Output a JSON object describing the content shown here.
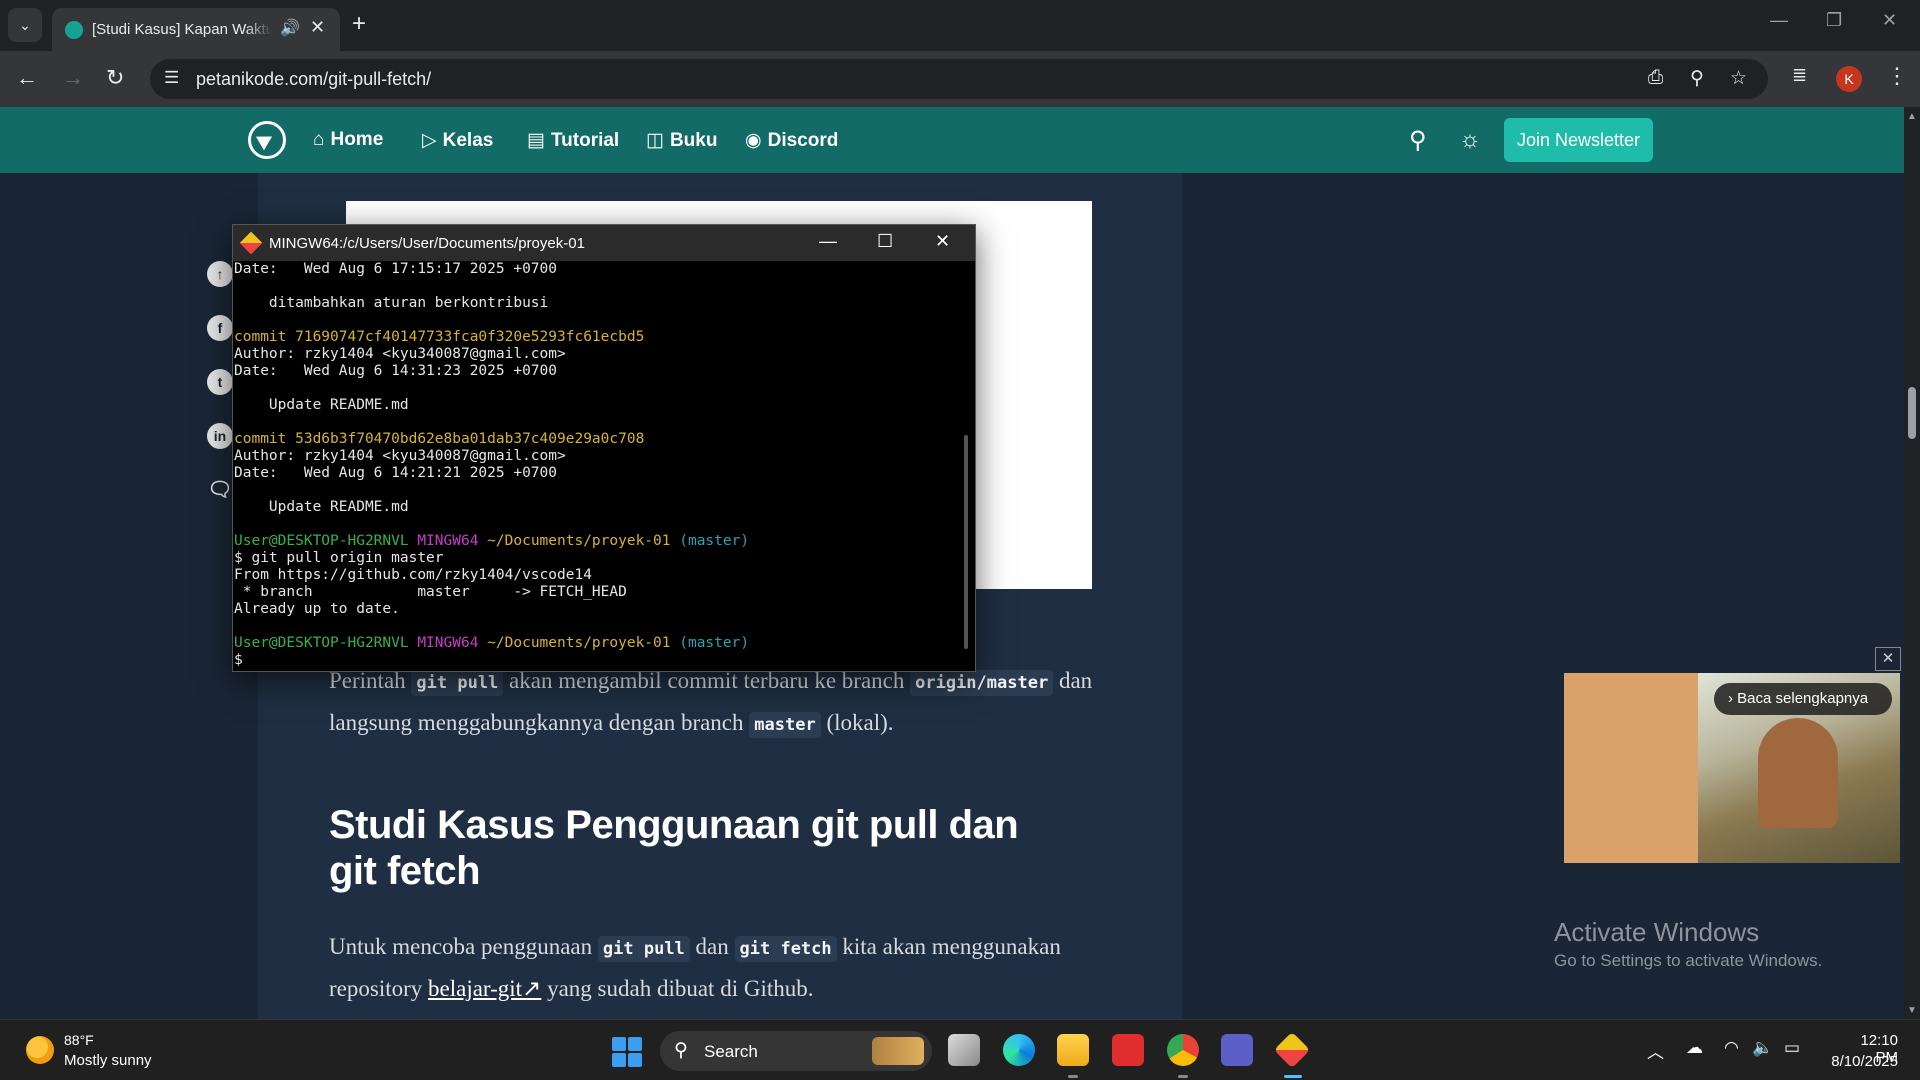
{
  "browser": {
    "tab_title": "[Studi Kasus] Kapan Waktu yang Tepat",
    "new_tab": "+",
    "url": "petanikode.com/git-pull-fetch/",
    "profile_initial": "K"
  },
  "site": {
    "nav": [
      {
        "label": "Home",
        "icon": "⌂"
      },
      {
        "label": "Kelas",
        "icon": "▷"
      },
      {
        "label": "Tutorial",
        "icon": "▤"
      },
      {
        "label": "Buku",
        "icon": "◫"
      },
      {
        "label": "Discord",
        "icon": "◉"
      }
    ],
    "join_label": "Join Newsletter",
    "accent": "#126b67",
    "button_color": "#1fbca9"
  },
  "article": {
    "para1_text1": "Perintah",
    "para1_code1": "git pull",
    "para1_text2": "akan mengambil commit terbaru ke branch",
    "para1_code2": "origin/master",
    "para1_text3": "dan langsung menggabungkannya dengan branch",
    "para1_code3": "master",
    "para1_text4": "(lokal).",
    "heading": "Studi Kasus Penggunaan git pull dan git fetch",
    "para2_text1": "Untuk mencoba penggunaan",
    "para2_code1": "git pull",
    "para2_text2": "dan",
    "para2_code2": "git fetch",
    "para2_text3": "kita akan",
    "para2_text4": "menggunakan repository",
    "para2_link": "belajar-git↗",
    "para2_text5": "yang sudah dibuat di Github."
  },
  "ad": {
    "cta": "› Baca selengkapnya",
    "close": "✕"
  },
  "watermark": {
    "title": "Activate Windows",
    "subtitle": "Go to Settings to activate Windows."
  },
  "terminal": {
    "title": "MINGW64:/c/Users/User/Documents/proyek-01",
    "lines": [
      {
        "segments": [
          {
            "t": "Date:   Wed Aug 6 17:15:17 2025 +0700",
            "c": ""
          }
        ]
      },
      {
        "segments": [
          {
            "t": "",
            "c": ""
          }
        ]
      },
      {
        "segments": [
          {
            "t": "    ditambahkan aturan berkontribusi",
            "c": ""
          }
        ]
      },
      {
        "segments": [
          {
            "t": "",
            "c": ""
          }
        ]
      },
      {
        "segments": [
          {
            "t": "commit 71690747cf40147733fca0f320e5293fc61ecbd5",
            "c": "y"
          }
        ]
      },
      {
        "segments": [
          {
            "t": "Author: rzky1404 <kyu340087@gmail.com>",
            "c": ""
          }
        ]
      },
      {
        "segments": [
          {
            "t": "Date:   Wed Aug 6 14:31:23 2025 +0700",
            "c": ""
          }
        ]
      },
      {
        "segments": [
          {
            "t": "",
            "c": ""
          }
        ]
      },
      {
        "segments": [
          {
            "t": "    Update README.md",
            "c": ""
          }
        ]
      },
      {
        "segments": [
          {
            "t": "",
            "c": ""
          }
        ]
      },
      {
        "segments": [
          {
            "t": "commit 53d6b3f70470bd62e8ba01dab37c409e29a0c708",
            "c": "y"
          }
        ]
      },
      {
        "segments": [
          {
            "t": "Author: rzky1404 <kyu340087@gmail.com>",
            "c": ""
          }
        ]
      },
      {
        "segments": [
          {
            "t": "Date:   Wed Aug 6 14:21:21 2025 +0700",
            "c": ""
          }
        ]
      },
      {
        "segments": [
          {
            "t": "",
            "c": ""
          }
        ]
      },
      {
        "segments": [
          {
            "t": "    Update README.md",
            "c": ""
          }
        ]
      },
      {
        "segments": [
          {
            "t": "",
            "c": ""
          }
        ]
      },
      {
        "segments": [
          {
            "t": "User@DESKTOP-HG2RNVL ",
            "c": "g"
          },
          {
            "t": "MINGW64 ",
            "c": "m"
          },
          {
            "t": "~/Documents/proyek-01 ",
            "c": "y"
          },
          {
            "t": "(master)",
            "c": "cy"
          }
        ]
      },
      {
        "segments": [
          {
            "t": "$ git pull origin master",
            "c": ""
          }
        ]
      },
      {
        "segments": [
          {
            "t": "From https://github.com/rzky1404/vscode14",
            "c": ""
          }
        ]
      },
      {
        "segments": [
          {
            "t": " * branch            master     -> FETCH_HEAD",
            "c": ""
          }
        ]
      },
      {
        "segments": [
          {
            "t": "Already up to date.",
            "c": ""
          }
        ]
      },
      {
        "segments": [
          {
            "t": "",
            "c": ""
          }
        ]
      },
      {
        "segments": [
          {
            "t": "User@DESKTOP-HG2RNVL ",
            "c": "g"
          },
          {
            "t": "MINGW64 ",
            "c": "m"
          },
          {
            "t": "~/Documents/proyek-01 ",
            "c": "y"
          },
          {
            "t": "(master)",
            "c": "cy"
          }
        ]
      },
      {
        "segments": [
          {
            "t": "$",
            "c": ""
          }
        ]
      }
    ]
  },
  "taskbar": {
    "temp": "88°F",
    "weather": "Mostly sunny",
    "search_label": "Search",
    "time": "12:10 PM",
    "date": "8/10/2025"
  }
}
